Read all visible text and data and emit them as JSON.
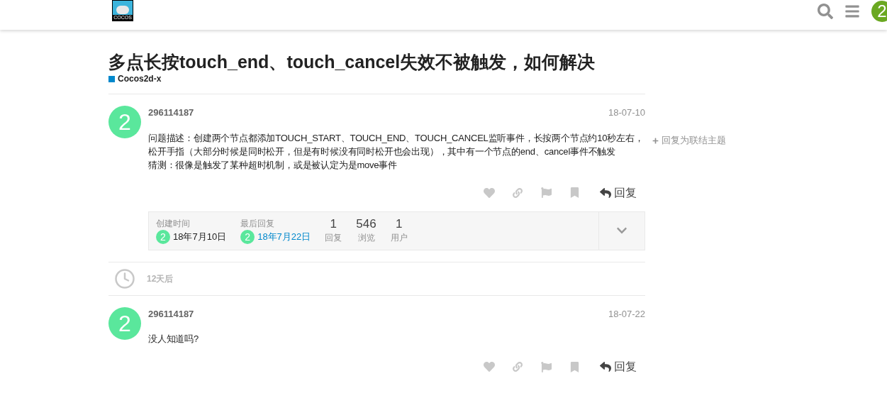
{
  "header": {
    "logo_text": "COCOS",
    "user_avatar": "2"
  },
  "topic": {
    "title": "多点长按touch_end、touch_cancel失效不被触发，如何解决",
    "category": {
      "name": "Cocos2d-x",
      "color": "#0088cc"
    }
  },
  "side_action": "回复为联结主题",
  "posts": [
    {
      "avatar": "2",
      "username": "296114187",
      "date": "18-07-10",
      "paragraphs": [
        "问题描述：创建两个节点都添加TOUCH_START、TOUCH_END、TOUCH_CANCEL监听事件，长按两个节点约10秒左右，松开手指（大部分时候是同时松开，但是有时候没有同时松开也会出现），其中有一个节点的end、cancel事件不触发",
        "猜测：很像是触发了某种超时机制，或是被认定为是move事件"
      ],
      "reply": "回复",
      "summary": {
        "created_label": "创建时间",
        "created_avatar": "2",
        "created_date": "18年7月10日",
        "last_label": "最后回复",
        "last_avatar": "2",
        "last_date": "18年7月22日",
        "stats": [
          {
            "value": "1",
            "label": "回复"
          },
          {
            "value": "546",
            "label": "浏览"
          },
          {
            "value": "1",
            "label": "用户"
          }
        ]
      }
    },
    {
      "gap": "12天后"
    },
    {
      "avatar": "2",
      "username": "296114187",
      "date": "18-07-22",
      "paragraphs": [
        "没人知道吗?"
      ],
      "reply": "回复"
    }
  ]
}
